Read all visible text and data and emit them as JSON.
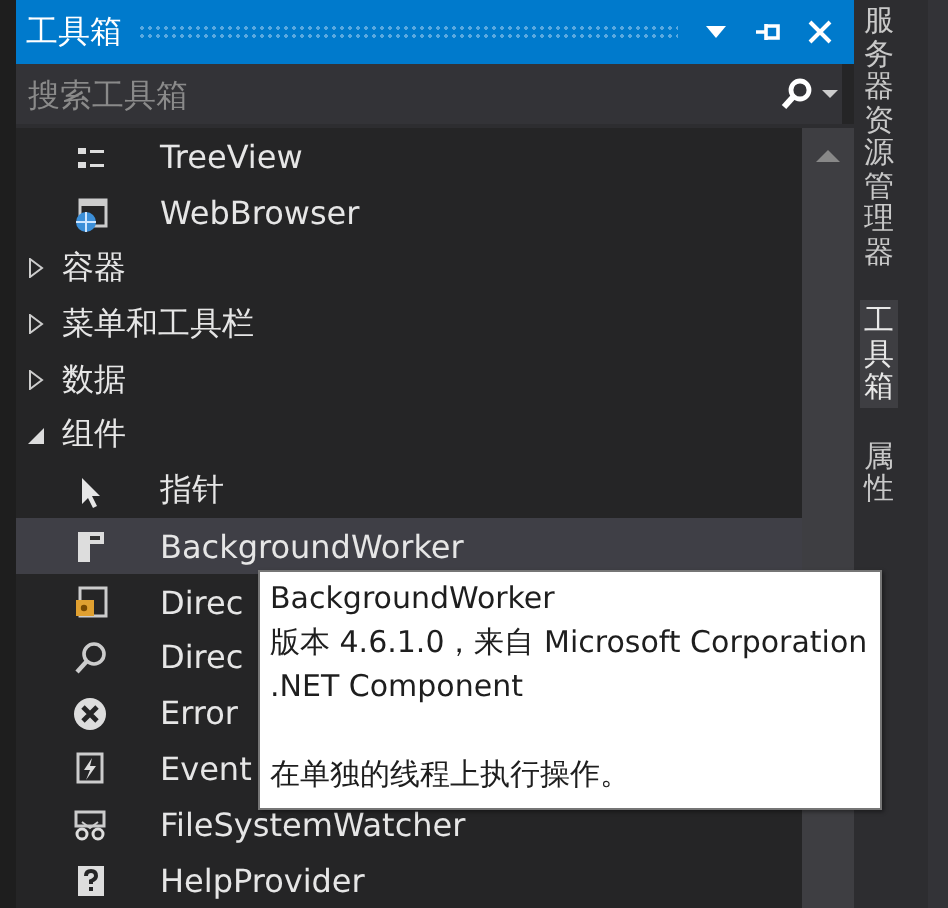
{
  "window": {
    "title": "工具箱"
  },
  "search": {
    "placeholder": "搜索工具箱"
  },
  "tree": [
    {
      "kind": "item",
      "label": "TreeView",
      "selected": false
    },
    {
      "kind": "item",
      "label": "WebBrowser",
      "selected": false
    },
    {
      "kind": "category",
      "label": "容器",
      "expanded": false
    },
    {
      "kind": "category",
      "label": "菜单和工具栏",
      "expanded": false
    },
    {
      "kind": "category",
      "label": "数据",
      "expanded": false
    },
    {
      "kind": "category",
      "label": "组件",
      "expanded": true,
      "children": [
        {
          "kind": "item",
          "label": "指针",
          "selected": false
        },
        {
          "kind": "item",
          "label": "BackgroundWorker",
          "selected": true
        },
        {
          "kind": "item",
          "label": "Direc",
          "selected": false
        },
        {
          "kind": "item",
          "label": "Direc",
          "selected": false
        },
        {
          "kind": "item",
          "label": "Error",
          "selected": false
        },
        {
          "kind": "item",
          "label": "Event",
          "selected": false
        },
        {
          "kind": "item",
          "label": "FileSystemWatcher",
          "selected": false
        },
        {
          "kind": "item",
          "label": "HelpProvider",
          "selected": false
        }
      ]
    }
  ],
  "side_tabs": [
    {
      "label": "服务器资源管理器",
      "selected": false
    },
    {
      "label": "工具箱",
      "selected": true
    },
    {
      "label": "属性",
      "selected": false
    }
  ],
  "tooltip": {
    "title": "BackgroundWorker",
    "lines": [
      "版本 4.6.1.0，来自 Microsoft Corporation",
      ".NET Component"
    ],
    "description": "在单独的线程上执行操作。"
  }
}
